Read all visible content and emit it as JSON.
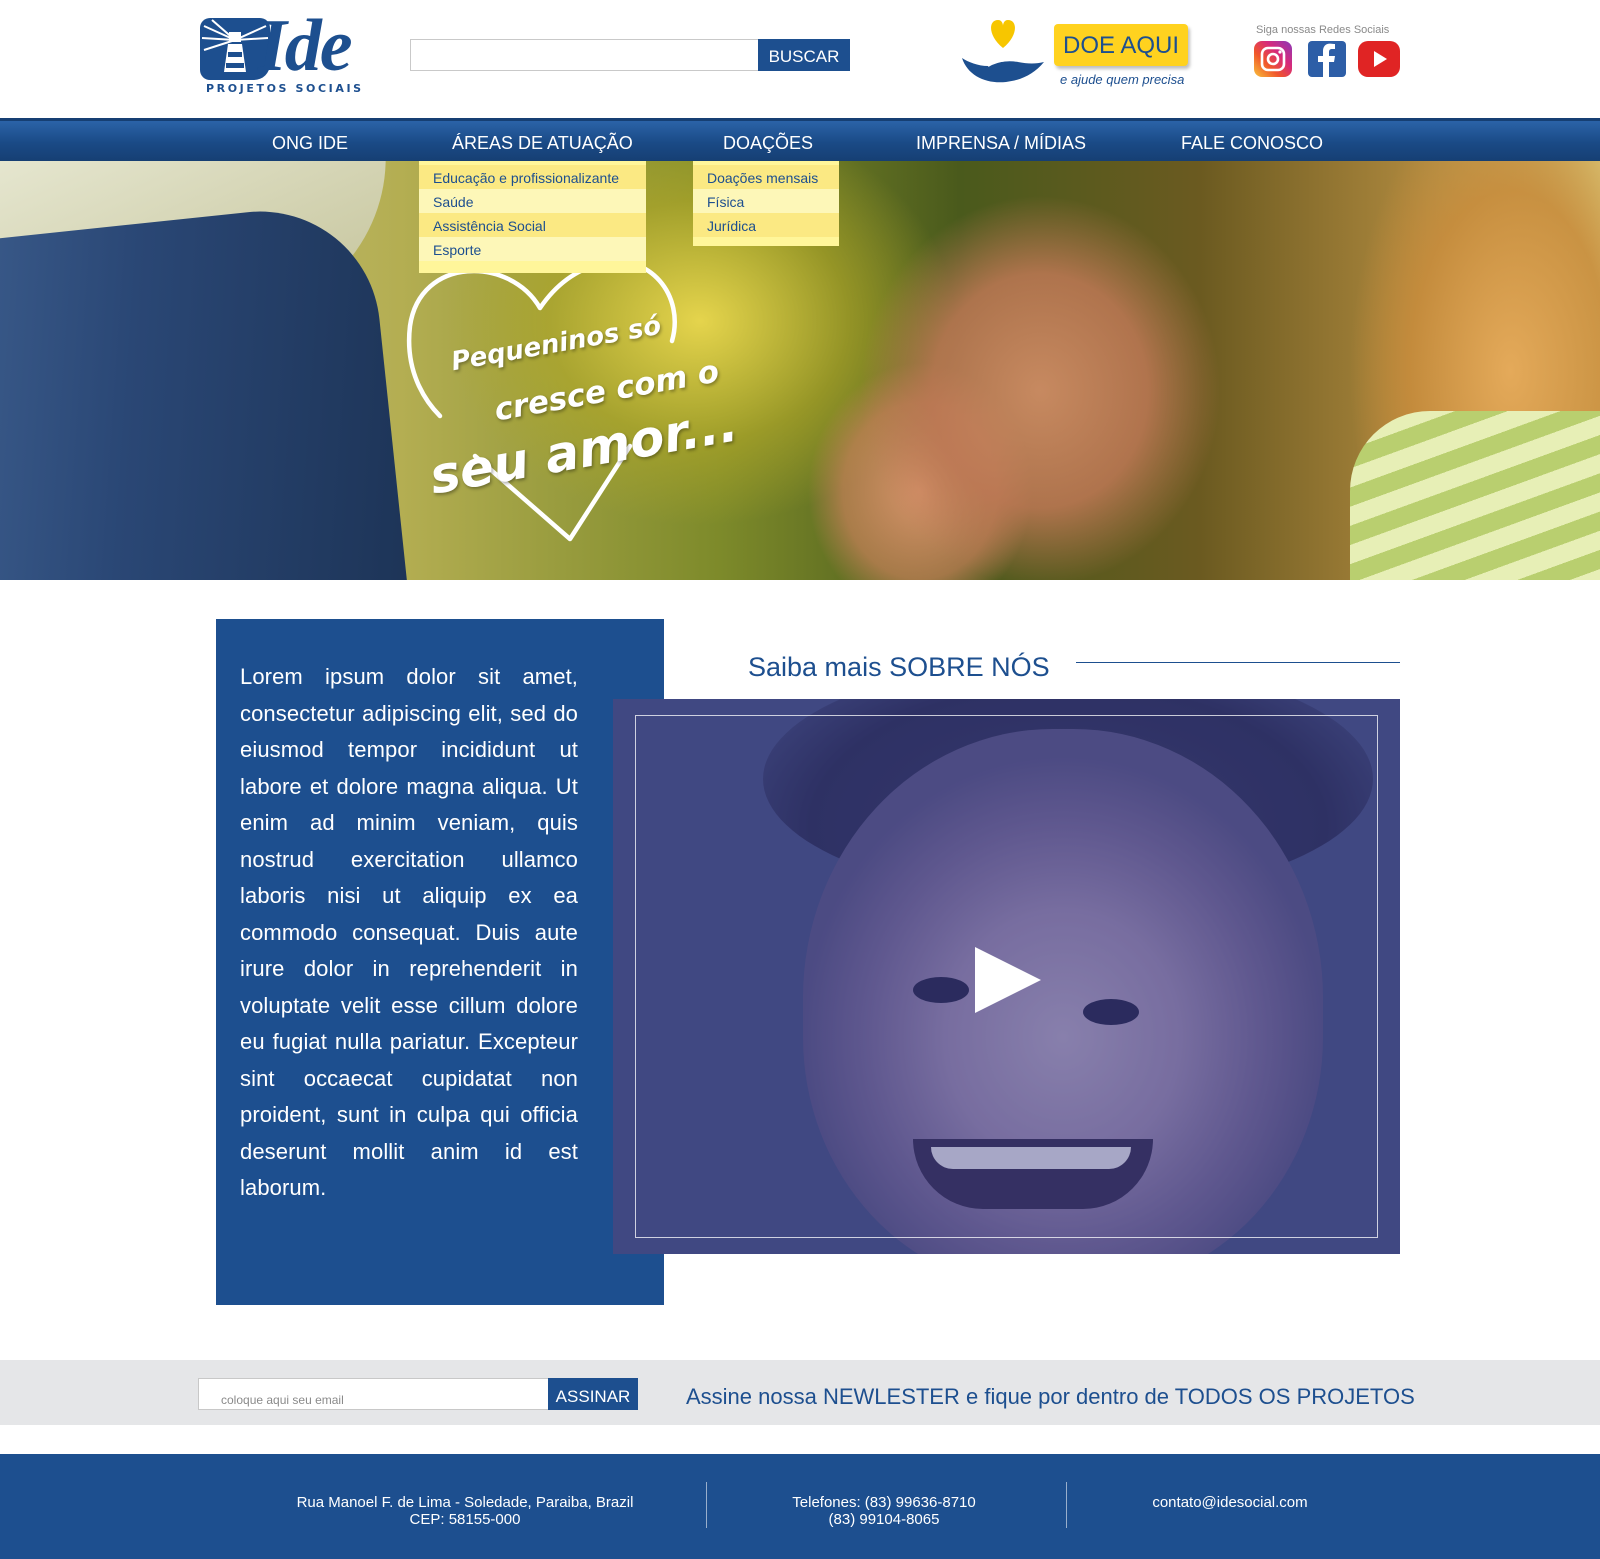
{
  "brand": {
    "logo_word": "Ide",
    "logo_sub": "PROJETOS SOCIAIS",
    "primary_color": "#1d4f8f",
    "accent_color": "#ffd21f"
  },
  "header": {
    "search": {
      "placeholder": "",
      "button_label": "BUSCAR"
    },
    "donate": {
      "button_label": "DOE AQUI",
      "subtitle": "e ajude quem precisa"
    },
    "social": {
      "label": "Siga nossas Redes Sociais",
      "icons": [
        "instagram-icon",
        "facebook-icon",
        "youtube-icon"
      ]
    }
  },
  "nav": {
    "items": [
      {
        "label": "ONG IDE"
      },
      {
        "label": "ÁREAS DE ATUAÇÃO"
      },
      {
        "label": "DOAÇÕES"
      },
      {
        "label": "IMPRENSA / MÍDIAS"
      },
      {
        "label": "FALE CONOSCO"
      }
    ],
    "areas_dropdown": [
      "Educação e profissionalizante",
      "Saúde",
      "Assistência Social",
      "Esporte"
    ],
    "doacoes_dropdown": [
      "Doações mensais",
      "Física",
      "Jurídica"
    ]
  },
  "hero": {
    "line1": "Pequeninos só",
    "line2": "cresce com o",
    "line3": "seu amor..."
  },
  "about": {
    "body": "Lorem ipsum dolor sit amet, consectetur adipiscing elit, sed do eiusmod tempor incididunt ut labore et dolore magna aliqua. Ut enim ad minim veniam, quis nostrud exercitation ullamco laboris nisi ut aliquip ex ea commodo consequat. Duis aute irure dolor in reprehenderit in voluptate velit esse cillum dolore eu fugiat nulla pariatur. Excepteur sint occaecat cupidatat non proident, sunt in culpa qui officia deserunt mollit anim id est laborum.",
    "heading": "Saiba mais SOBRE NÓS"
  },
  "newsletter": {
    "placeholder": "coloque aqui seu email",
    "button_label": "ASSINAR",
    "text": "Assine nossa NEWLESTER e fique por dentro de TODOS OS PROJETOS"
  },
  "footer": {
    "address_line1": "Rua Manoel F. de Lima - Soledade, Paraiba, Brazil",
    "address_line2": "CEP: 58155-000",
    "phone_line1": "Telefones: (83) 99636-8710",
    "phone_line2": "(83) 99104-8065",
    "email": "contato@idesocial.com"
  }
}
